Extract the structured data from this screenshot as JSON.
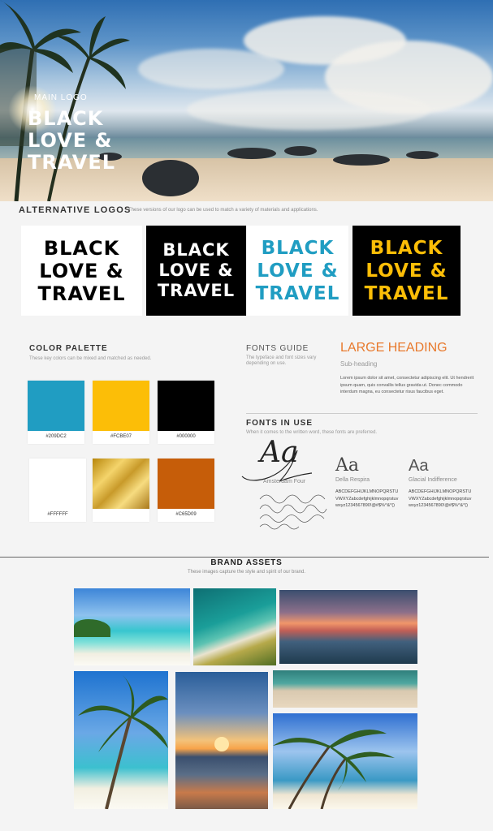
{
  "hero": {
    "main_logo_label": "MAIN LOGO",
    "logo_lines": [
      "BLACK",
      "LOVE &",
      "TRAVEL"
    ]
  },
  "alternative_logos": {
    "title": "ALTERNATIVE LOGOS",
    "subtitle": "These versions of our logo can be used to match a variety of materials and applications.",
    "cards": [
      {
        "lines": [
          "BLACK",
          "LOVE &",
          "TRAVEL"
        ],
        "bg": "#FFFFFF",
        "fg": "#000000"
      },
      {
        "lines": [
          "BLACK",
          "LOVE &",
          "TRAVEL"
        ],
        "bg": "#000000",
        "fg": "#FFFFFF"
      },
      {
        "lines": [
          "BLACK",
          "LOVE &",
          "TRAVEL"
        ],
        "bg": "#FFFFFF",
        "fg": "#209DC2"
      },
      {
        "lines": [
          "BLACK",
          "LOVE &",
          "TRAVEL"
        ],
        "bg": "#000000",
        "fg": "#FCBE07"
      }
    ]
  },
  "color_palette": {
    "title": "COLOR PALETTE",
    "subtitle": "These key colors can be mixed and matched as needed.",
    "swatches": [
      {
        "code": "#209DC2",
        "color": "#209DC2"
      },
      {
        "code": "#FCBE07",
        "color": "#FCBE07"
      },
      {
        "code": "#000000",
        "color": "#000000"
      },
      {
        "code": "#FFFFFF",
        "color": "#FFFFFF"
      },
      {
        "code": "",
        "color": "gold-texture"
      },
      {
        "code": "#C65D09",
        "color": "#C65D09"
      }
    ]
  },
  "fonts_guide": {
    "title": "FONTS GUIDE",
    "subtitle": "The typeface and font sizes vary depending on use.",
    "large_heading": "LARGE HEADING",
    "sub_heading": "Sub-heading",
    "body": "Lorem ipsum dolor sit amet, consectetur adipiscing elit. Ut hendrerit ipsum quam, quis convallis tellus gravida ut. Donec commodo interdum magna, eu consectetur risus faucibus eget.",
    "accent_color": "#E8792C"
  },
  "fonts_in_use": {
    "title": "FONTS IN USE",
    "subtitle": "When it comes to the written word, these fonts are preferred.",
    "fonts": [
      {
        "sample": "Aa",
        "name": "Amsterdam Four",
        "glyphs": ""
      },
      {
        "sample": "Aa",
        "name": "Della Respira",
        "glyphs": "ABCDEFGHIJKLMNOPQRSTUVWXYZabcdefghijklmnopqrstuvwxyz1234567890!@#$%^&*()"
      },
      {
        "sample": "Aa",
        "name": "Glacial Indifference",
        "glyphs": "ABCDEFGHIJKLMNOPQRSTUVWXYZabcdefghijklmnopqrstuvwxyz1234567890!@#$%^&*()"
      }
    ]
  },
  "brand_assets": {
    "title": "BRAND ASSETS",
    "subtitle": "These images capture the style and spirit of our brand."
  }
}
